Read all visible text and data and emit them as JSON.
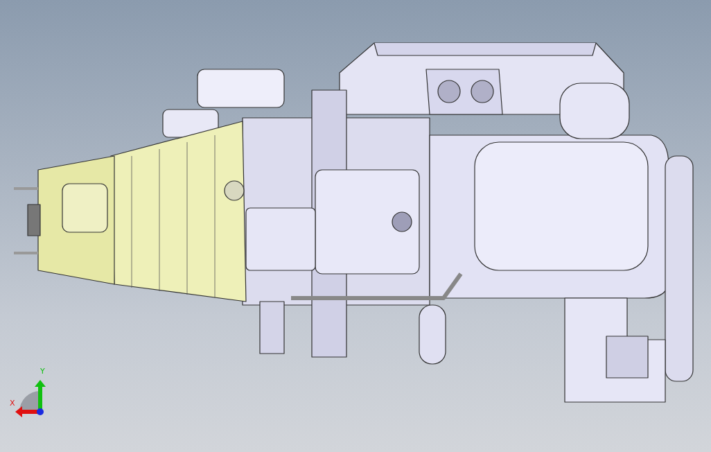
{
  "viewport": {
    "triad": [
      {
        "kind": "x",
        "label": "X"
      },
      {
        "kind": "y",
        "label": "Y"
      }
    ]
  }
}
